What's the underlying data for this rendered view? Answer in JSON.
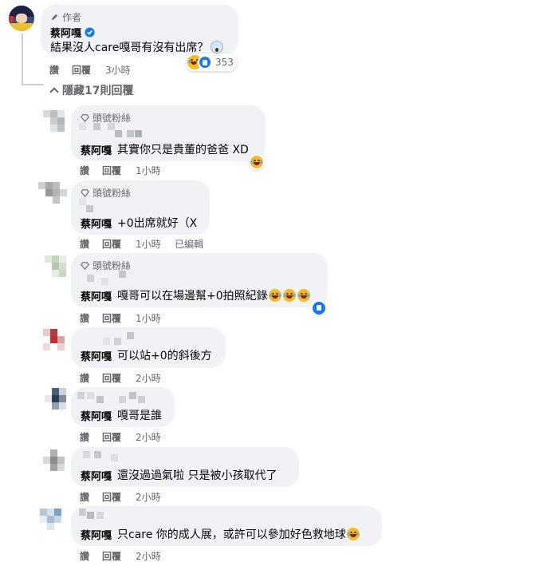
{
  "main_comment": {
    "badge": "作者",
    "name": "蔡阿嘎",
    "text": "結果沒人care嘎哥有沒有出席？",
    "reaction_count": "353",
    "actions": {
      "like": "讚",
      "reply": "回覆",
      "time": "3小時"
    }
  },
  "hide_replies": "隱藏17則回覆",
  "replies": [
    {
      "badge": "頭號粉絲",
      "mention": "蔡阿嘎",
      "text": "其實你只是貴董的爸爸 XD",
      "like": "讚",
      "reply": "回覆",
      "time": "1小時",
      "edited": ""
    },
    {
      "badge": "頭號粉絲",
      "mention": "蔡阿嘎",
      "text": "+0出席就好（X",
      "like": "讚",
      "reply": "回覆",
      "time": "1小時",
      "edited": "已編輯"
    },
    {
      "badge": "頭號粉絲",
      "mention": "蔡阿嘎",
      "text": "嘎哥可以在場邊幫+0拍照紀錄",
      "like": "讚",
      "reply": "回覆",
      "time": "1小時",
      "edited": ""
    },
    {
      "badge": "",
      "mention": "蔡阿嘎",
      "text": "可以站+0的斜後方",
      "like": "讚",
      "reply": "回覆",
      "time": "2小時",
      "edited": ""
    },
    {
      "badge": "",
      "mention": "蔡阿嘎",
      "text": "嘎哥是誰",
      "like": "讚",
      "reply": "回覆",
      "time": "2小時",
      "edited": ""
    },
    {
      "badge": "",
      "mention": "蔡阿嘎",
      "text": "還沒過過氣啦 只是被小孩取代了",
      "like": "讚",
      "reply": "回覆",
      "time": "2小時",
      "edited": ""
    },
    {
      "badge": "",
      "mention": "蔡阿嘎",
      "text": "只care 你的成人展，或許可以參加好色救地球",
      "like": "讚",
      "reply": "回覆",
      "time": "2小時",
      "edited": ""
    }
  ],
  "colors": {
    "bubble": "#f0f2f5",
    "secondary_text": "#65676b",
    "like_blue": "#1877f2",
    "verified_blue": "#1877f2"
  }
}
